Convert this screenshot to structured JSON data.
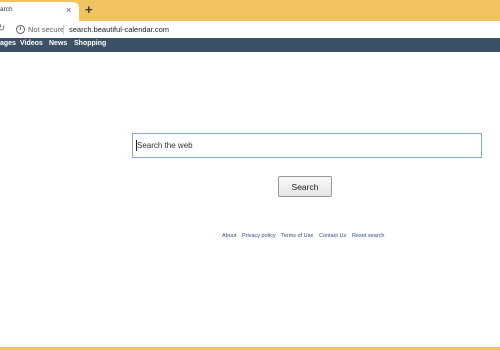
{
  "browser": {
    "tab_title": "arch",
    "close_glyph": "×",
    "new_tab_glyph": "+",
    "info_glyph": "i",
    "security_label": "Not secure",
    "url": "search.beautiful-calendar.com",
    "reload_glyph": "↻",
    "accent_color": "#f2c45f"
  },
  "nav": {
    "items": [
      "ages",
      "Videos",
      "News",
      "Shopping"
    ],
    "background": "#3d5166"
  },
  "search": {
    "placeholder": "Search the web",
    "value": "",
    "button_label": "Search"
  },
  "footer": {
    "links": [
      "About",
      "Privacy policy",
      "Terms of Use",
      "Contact Us",
      "Reset search"
    ]
  },
  "icons": [
    "close-icon",
    "new-tab-icon",
    "reload-icon",
    "info-icon"
  ]
}
